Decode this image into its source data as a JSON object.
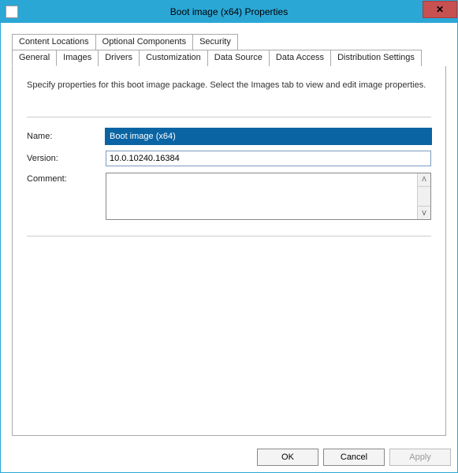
{
  "window": {
    "title": "Boot image (x64) Properties",
    "close_symbol": "✕"
  },
  "tabs": {
    "row1": [
      {
        "label": "Content Locations"
      },
      {
        "label": "Optional Components"
      },
      {
        "label": "Security"
      }
    ],
    "row2": [
      {
        "label": "General"
      },
      {
        "label": "Images"
      },
      {
        "label": "Drivers"
      },
      {
        "label": "Customization"
      },
      {
        "label": "Data Source"
      },
      {
        "label": "Data Access"
      },
      {
        "label": "Distribution Settings"
      }
    ],
    "active": "General"
  },
  "panel": {
    "description": "Specify properties for this boot image package. Select the Images tab to view and edit image properties.",
    "labels": {
      "name": "Name:",
      "version": "Version:",
      "comment": "Comment:"
    },
    "values": {
      "name": "Boot image (x64)",
      "version": "10.0.10240.16384",
      "comment": ""
    }
  },
  "buttons": {
    "ok": "OK",
    "cancel": "Cancel",
    "apply": "Apply"
  },
  "icons": {
    "up": "ᐱ",
    "down": "ᐯ"
  }
}
